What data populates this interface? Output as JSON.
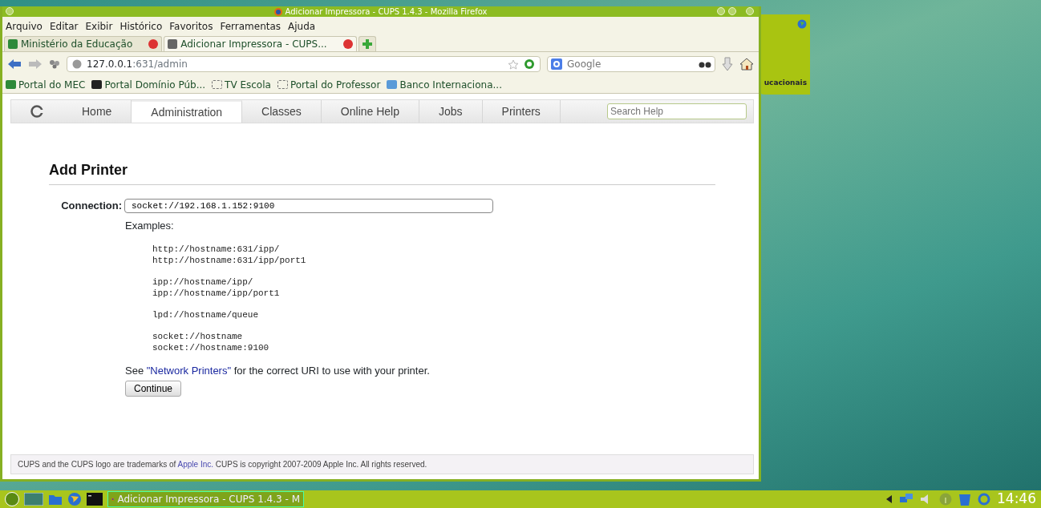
{
  "window": {
    "title": "Adicionar Impressora - CUPS 1.4.3 - Mozilla Firefox"
  },
  "menu": [
    "Arquivo",
    "Editar",
    "Exibir",
    "Histórico",
    "Favoritos",
    "Ferramentas",
    "Ajuda"
  ],
  "tabs": [
    {
      "label": "Ministério da Educação",
      "selected": false
    },
    {
      "label": "Adicionar Impressora - CUPS...",
      "selected": true
    }
  ],
  "address": {
    "host": "127.0.0.1",
    "path": ":631/admin"
  },
  "search": {
    "placeholder": "Google"
  },
  "bookmarks": [
    {
      "label": "Portal do MEC",
      "kind": "flag"
    },
    {
      "label": "Portal Domínio Púb...",
      "kind": "dp"
    },
    {
      "label": "TV Escola",
      "kind": "blank"
    },
    {
      "label": "Portal do Professor",
      "kind": "blank"
    },
    {
      "label": "Banco Internaciona...",
      "kind": "globe"
    }
  ],
  "cups_nav": [
    {
      "label": "Home",
      "selected": false
    },
    {
      "label": "Administration",
      "selected": true
    },
    {
      "label": "Classes",
      "selected": false
    },
    {
      "label": "Online Help",
      "selected": false
    },
    {
      "label": "Jobs",
      "selected": false
    },
    {
      "label": "Printers",
      "selected": false
    }
  ],
  "help_search": {
    "placeholder": "Search Help"
  },
  "heading": "Add Printer",
  "connection": {
    "label": "Connection:",
    "value": "socket://192.168.1.152:9100"
  },
  "examples_label": "Examples:",
  "examples": [
    [
      "http://hostname:631/ipp/",
      "http://hostname:631/ipp/port1"
    ],
    [
      "ipp://hostname/ipp/",
      "ipp://hostname/ipp/port1"
    ],
    [
      "lpd://hostname/queue"
    ],
    [
      "socket://hostname",
      "socket://hostname:9100"
    ]
  ],
  "note": {
    "before": "See ",
    "link": "\"Network Printers\"",
    "after": " for the correct URI to use with your printer."
  },
  "continue_button": "Continue",
  "footer": {
    "before": "CUPS and the CUPS logo are trademarks of ",
    "link": "Apple Inc.",
    "after": " CUPS is copyright 2007-2009 Apple Inc. All rights reserved."
  },
  "desktop_widget": {
    "label": "ucacionais"
  },
  "taskbar": {
    "task": "Adicionar Impressora - CUPS 1.4.3 - M",
    "clock": "14:46"
  }
}
